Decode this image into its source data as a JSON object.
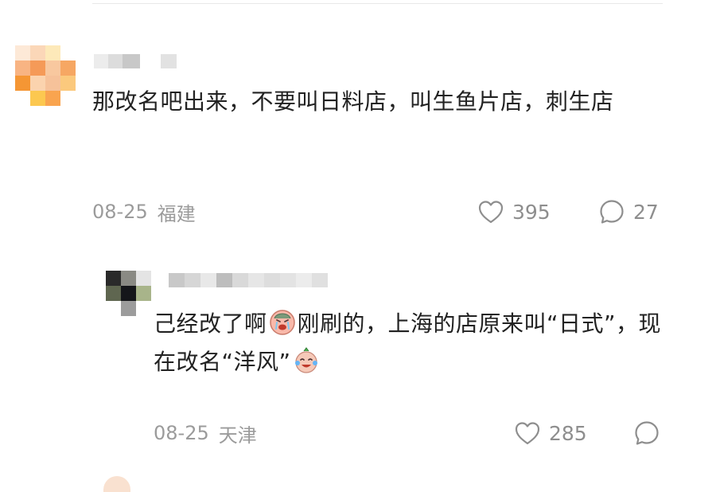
{
  "comments": [
    {
      "text": "那改名吧出来，不要叫日料店，叫生鱼片店，刺生店",
      "date": "08-25",
      "location": "福建",
      "likes": "395",
      "replies": "27"
    }
  ],
  "reply": {
    "text_before_emoji": "己经改了啊",
    "text_after_emoji": "刚刷的，上海的店原来叫“日式”，现在改名“洋风”",
    "date": "08-25",
    "location": "天津",
    "likes": "285"
  },
  "icons": {
    "like": "heart-outline-icon",
    "reply": "speech-bubble-outline-icon",
    "emoji_1": "crying-face-emoji",
    "emoji_2": "laughing-crying-face-emoji"
  },
  "colors": {
    "text_primary": "#222222",
    "text_meta": "#9b9b9b",
    "icon": "#8e8e8e",
    "divider": "#e8e8e8"
  }
}
